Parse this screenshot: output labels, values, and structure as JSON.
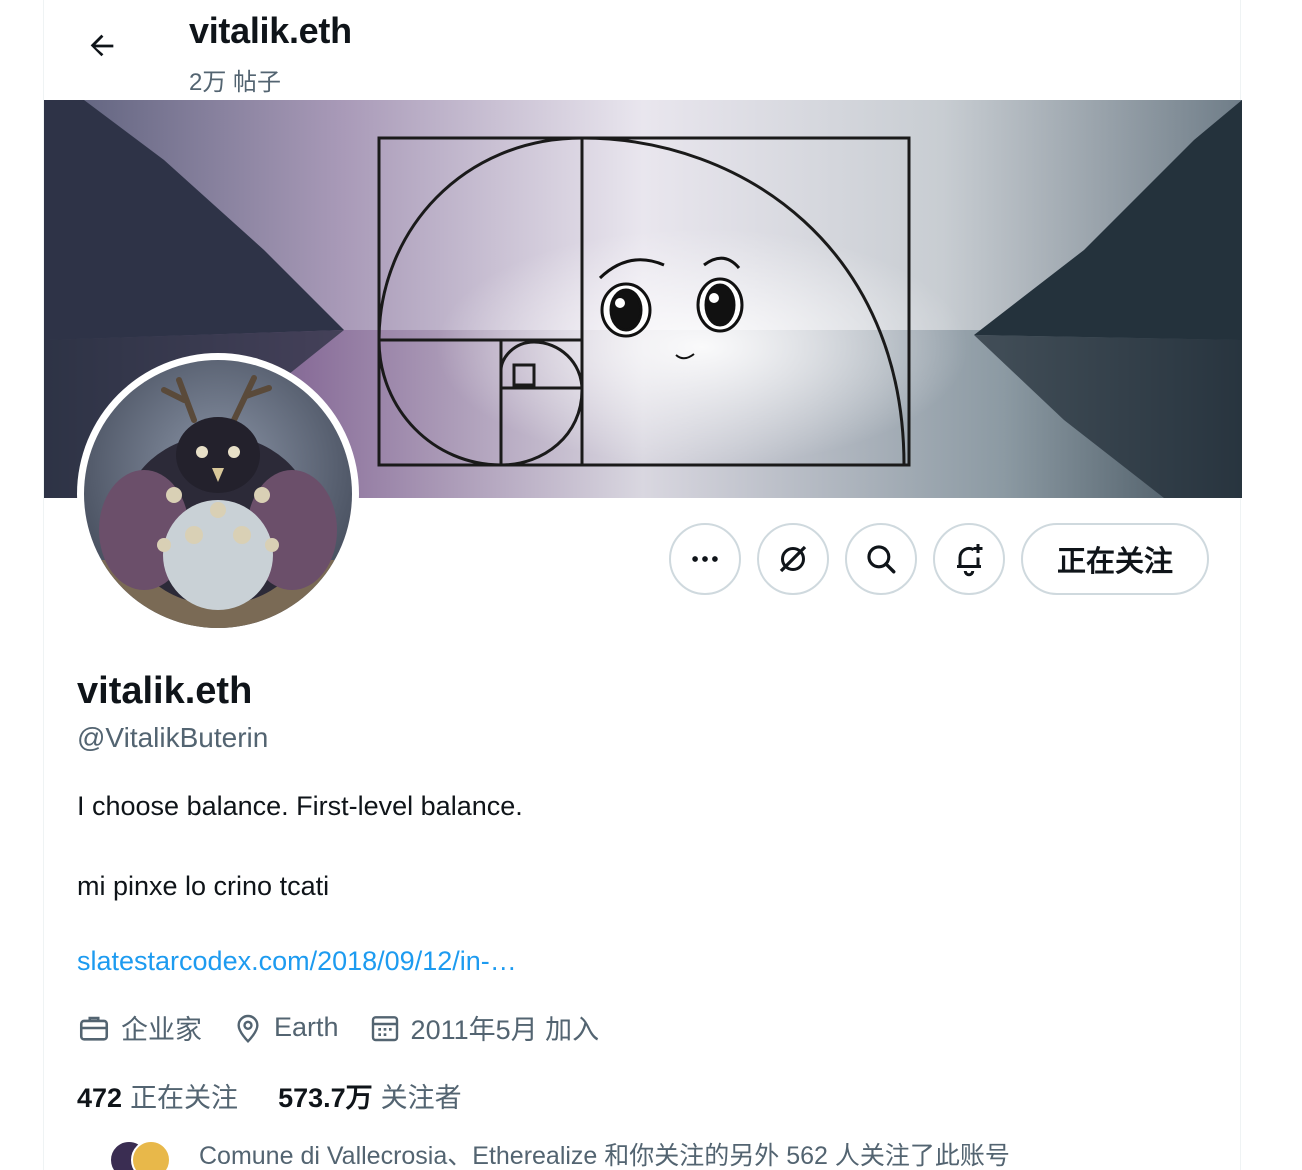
{
  "header": {
    "title": "vitalik.eth",
    "posts_count": "2万 帖子"
  },
  "profile": {
    "display_name": "vitalik.eth",
    "handle": "@VitalikButerin",
    "bio_line1": "I choose balance. First-level balance.",
    "bio_line2": "mi pinxe lo crino tcati",
    "link": "slatestarcodex.com/2018/09/12/in-…",
    "profession": "企业家",
    "location": "Earth",
    "joined": "2011年5月 加入",
    "following_count": "472",
    "following_label": "正在关注",
    "followers_count": "573.7万",
    "followers_label": "关注者",
    "followed_by_text": "Comune di Vallecrosia、Etherealize 和你关注的另外 562 人关注了此账号"
  },
  "actions": {
    "more_icon": "more-icon",
    "grok_icon": "grok-icon",
    "search_icon": "search-icon",
    "notify_icon": "bell-plus-icon",
    "follow_state_label": "正在关注"
  },
  "colors": {
    "accent": "#1d9bf0",
    "secondary_text": "#536471",
    "border": "#cfd9de"
  }
}
